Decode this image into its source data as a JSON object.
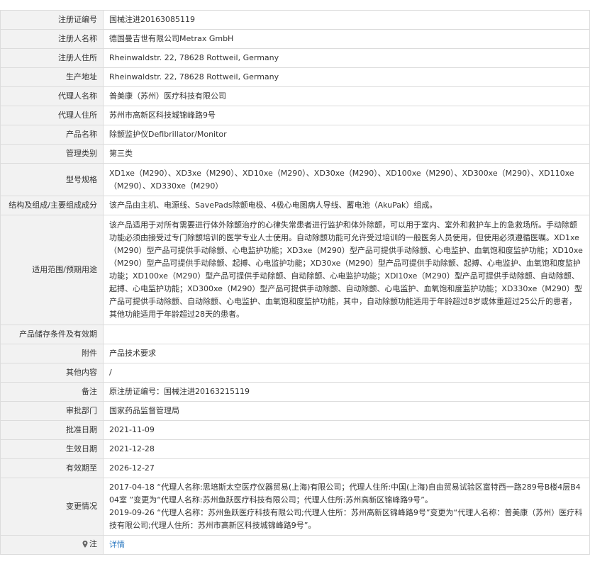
{
  "rows": [
    {
      "label": "注册证编号",
      "value": "国械注进20163085119"
    },
    {
      "label": "注册人名称",
      "value": "德国曼吉世有限公司Metrax GmbH"
    },
    {
      "label": "注册人住所",
      "value": "Rheinwaldstr. 22, 78628 Rottweil, Germany"
    },
    {
      "label": "生产地址",
      "value": "Rheinwaldstr. 22, 78628 Rottweil, Germany"
    },
    {
      "label": "代理人名称",
      "value": "普美康（苏州）医疗科技有限公司"
    },
    {
      "label": "代理人住所",
      "value": "苏州市高新区科技城锦峰路9号"
    },
    {
      "label": "产品名称",
      "value": "除颤监护仪Defibrillator/Monitor"
    },
    {
      "label": "管理类别",
      "value": "第三类"
    },
    {
      "label": "型号规格",
      "value": "XD1xe（M290）、XD3xe（M290）、XD10xe（M290）、XD30xe（M290）、XD100xe（M290）、XD300xe（M290）、XD110xe（M290）、XD330xe（M290）"
    },
    {
      "label": "结构及组成/主要组成成分",
      "value": "该产品由主机、电源线、SavePads除颤电极、4极心电图病人导线、蓄电池（AkuPak）组成。"
    },
    {
      "label": "适用范围/预期用途",
      "value": "该产品适用于对所有需要进行体外除颤治疗的心律失常患者进行监护和体外除颤，可以用于室内、室外和救护车上的急救场所。手动除颤功能必须由接受过专门除颤培训的医学专业人士使用。自动除颤功能可允许受过培训的一般医务人员使用，但使用必须遵循医嘱。XD1xe（M290）型产品可提供手动除颤、心电监护功能；XD3xe（M290）型产品可提供手动除颤、心电监护、血氧饱和度监护功能；XD10xe（M290）型产品可提供手动除颤、起搏、心电监护功能；XD30xe（M290）型产品可提供手动除颤、起搏、心电监护、血氧饱和度监护功能；XD100xe（M290）型产品可提供手动除颤、自动除颤、心电监护功能；XDl10xe（M290）型产品可提供手动除颤、自动除颤、起搏、心电监护功能；XD300xe（M290）型产品可提供手动除颤、自动除颤、心电监护、血氧饱和度监护功能；XD330xe（M290）型产品可提供手动除颤、自动除颤、心电监护、血氧饱和度监护功能，其中，自动除颤功能适用于年龄超过8岁或体重超过25公斤的患者，其他功能适用于年龄超过28天的患者。"
    },
    {
      "label": "产品储存条件及有效期",
      "value": ""
    },
    {
      "label": "附件",
      "value": "产品技术要求"
    },
    {
      "label": "其他内容",
      "value": "/"
    },
    {
      "label": "备注",
      "value": "原注册证编号：国械注进20163215119"
    },
    {
      "label": "审批部门",
      "value": "国家药品监督管理局"
    },
    {
      "label": "批准日期",
      "value": "2021-11-09"
    },
    {
      "label": "生效日期",
      "value": "2021-12-28"
    },
    {
      "label": "有效期至",
      "value": "2026-12-27"
    }
  ],
  "changes": {
    "label": "变更情况",
    "entries": [
      "2017-04-18 “代理人名称:思培斯太空医疗仪器贸易(上海)有限公司；代理人住所:中国(上海)自由贸易试验区富特西一路289号B楼4层B404室 ”变更为“代理人名称:苏州鱼跃医疗科技有限公司；代理人住所:苏州高新区锦峰路9号”。",
      "2019-09-26 “代理人名称：苏州鱼跃医疗科技有限公司;代理人住所：苏州高新区锦峰路9号”变更为“代理人名称：普美康（苏州）医疗科技有限公司;代理人住所：苏州市高新区科技城锦峰路9号”。"
    ]
  },
  "note": {
    "icon": "pin-icon",
    "label": "注",
    "link_text": "详情"
  },
  "colors": {
    "label_bg": "#f2f2f2",
    "border": "#dcdcdc",
    "link": "#2f7bc2",
    "text": "#333333"
  }
}
